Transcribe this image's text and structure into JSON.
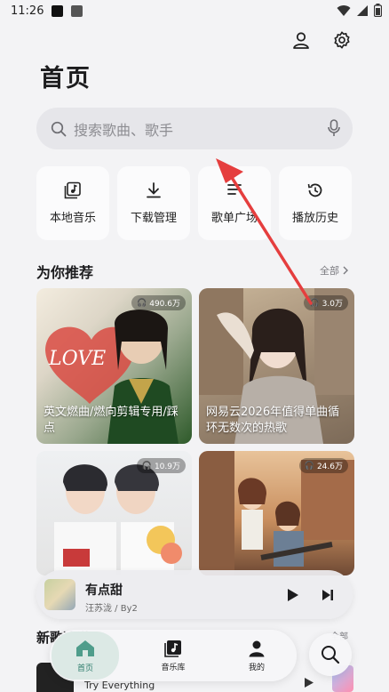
{
  "status_bar": {
    "time": "11:26"
  },
  "header": {
    "title": "首页"
  },
  "search": {
    "placeholder": "搜索歌曲、歌手"
  },
  "quick_actions": [
    {
      "label": "本地音乐",
      "icon": "local-music-icon"
    },
    {
      "label": "下载管理",
      "icon": "download-icon"
    },
    {
      "label": "歌单广场",
      "icon": "playlist-icon"
    },
    {
      "label": "播放历史",
      "icon": "history-icon"
    }
  ],
  "recommend": {
    "title": "为你推荐",
    "more": "全部",
    "cards": [
      {
        "count": "490.6万",
        "caption": "英文燃曲/燃向剪辑专用/踩点"
      },
      {
        "count": "3.0万",
        "caption": "网易云2026年值得单曲循环无数次的热歌"
      },
      {
        "count": "10.9万",
        "caption": ""
      },
      {
        "count": "24.6万",
        "caption": ""
      }
    ]
  },
  "player": {
    "song": "有点甜",
    "artist": "汪苏泷 / By2"
  },
  "below_section": {
    "title": "新歌速递",
    "more": "全部",
    "peek_text": "Try Everything"
  },
  "nav": {
    "items": [
      {
        "label": "首页",
        "icon": "home-icon",
        "active": true
      },
      {
        "label": "音乐库",
        "icon": "music-library-icon",
        "active": false
      },
      {
        "label": "我的",
        "icon": "profile-icon",
        "active": false
      }
    ]
  },
  "colors": {
    "accent": "#2f7d6d",
    "annotation_arrow": "#e53e3e"
  }
}
